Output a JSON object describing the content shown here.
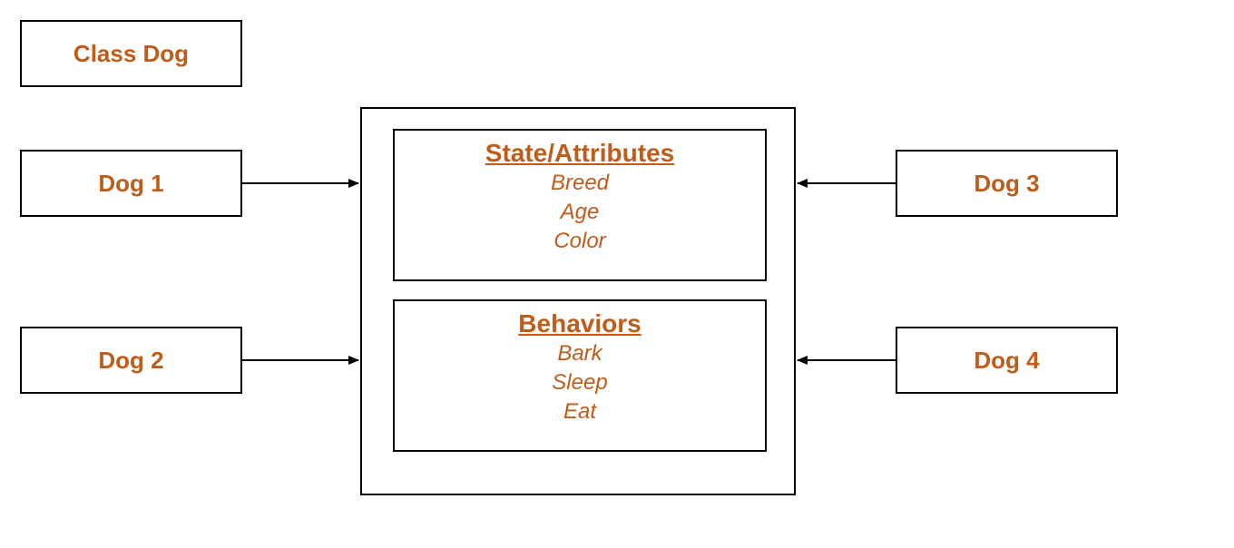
{
  "classBox": {
    "label": "Class Dog"
  },
  "instances": {
    "dog1": "Dog 1",
    "dog2": "Dog 2",
    "dog3": "Dog 3",
    "dog4": "Dog 4"
  },
  "sections": {
    "attributes": {
      "title": "State/Attributes",
      "items": [
        "Breed",
        "Age",
        "Color"
      ]
    },
    "behaviors": {
      "title": "Behaviors",
      "items": [
        "Bark",
        "Sleep",
        "Eat"
      ]
    }
  }
}
